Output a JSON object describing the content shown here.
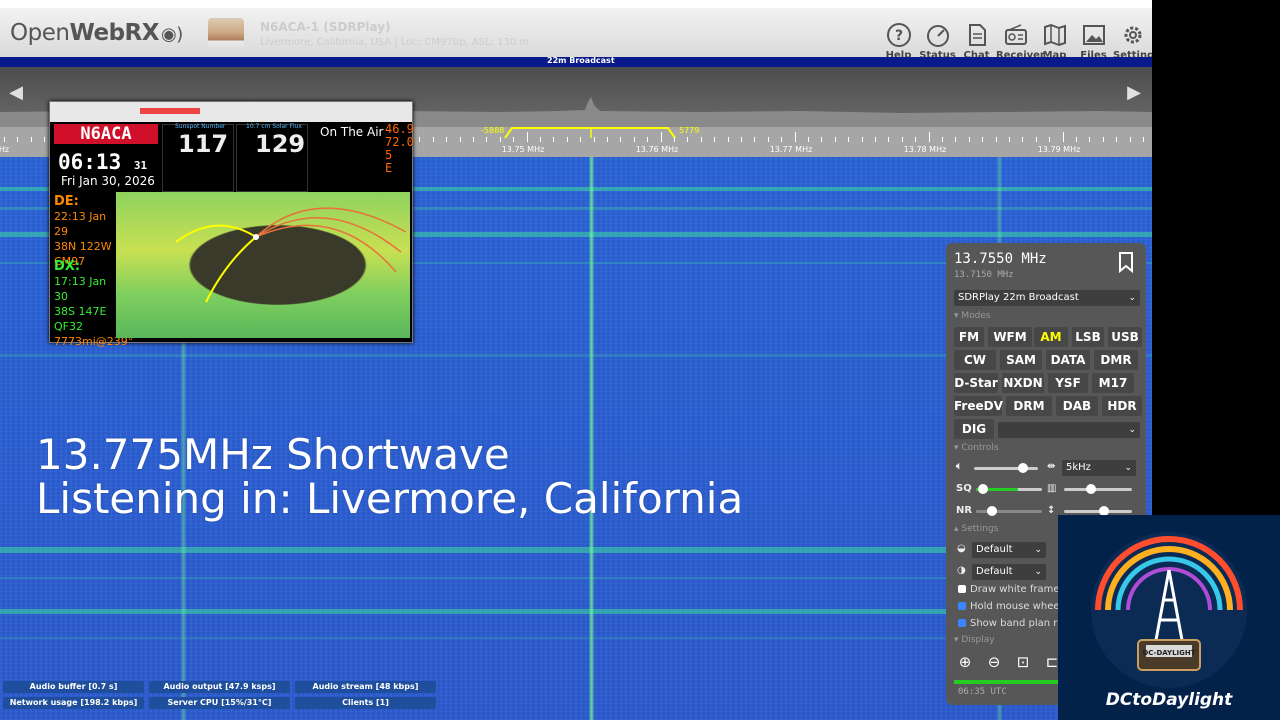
{
  "app": {
    "logo_light": "Open",
    "logo_bold": "WebRX",
    "receiver_name": "N6ACA-1 (SDRPlay)",
    "receiver_location": "Livermore, California, USA | Loc: CM97bp, ASL: 130 m"
  },
  "nav": [
    {
      "label": "Help",
      "icon": "help-icon"
    },
    {
      "label": "Status",
      "icon": "gauge-icon"
    },
    {
      "label": "Chat",
      "icon": "document-icon"
    },
    {
      "label": "Receiver",
      "icon": "radio-icon"
    },
    {
      "label": "Map",
      "icon": "map-icon"
    },
    {
      "label": "Files",
      "icon": "image-icon"
    },
    {
      "label": "Settings",
      "icon": "gear-icon"
    }
  ],
  "bandplan": {
    "label": "22m Broadcast"
  },
  "scale": {
    "labels": [
      "13.75 MHz",
      "13.76 MHz",
      "13.77 MHz",
      "13.78 MHz",
      "13.79 MHz"
    ],
    "left_edge_label": "Hz",
    "passband_low": "-5888",
    "passband_high": "5779"
  },
  "overlay": {
    "line1": "13.775MHz Shortwave",
    "line2": "Listening in: Livermore, California"
  },
  "inset": {
    "callsign": "N6ACA",
    "time": "06:13",
    "seconds": "31",
    "date": "Fri Jan 30, 2026",
    "sunspot": "117",
    "solar_flux": "129",
    "caption_sunspot": "Sunspot Number",
    "caption_flux": "10.7 cm Solar Flux",
    "on_air": "On The Air",
    "wx_temp": "46.9",
    "wx_humidity": "72.0",
    "wx_wind": "5",
    "wx_dir": "E",
    "de_label": "DE:",
    "de_time": "22:13 Jan 29",
    "de_latlon": "38N 122W",
    "de_grid": "CM97",
    "dx_label": "DX:",
    "dx_time": "17:13 Jan 30",
    "dx_latlon": "38S 147E",
    "dx_grid": "QF32",
    "dx_dist": "7773mi@239°"
  },
  "panel": {
    "frequency": "13.7550 MHz",
    "sub_frequency": "13.7150 MHz",
    "profile": "SDRPlay 22m Broadcast",
    "modes_label": "Modes",
    "modes": [
      "FM",
      "WFM",
      "AM",
      "LSB",
      "USB",
      "CW",
      "SAM",
      "DATA",
      "DMR",
      "D-Star",
      "NXDN",
      "YSF",
      "M17",
      "FreeDV",
      "DRM",
      "DAB",
      "HDR",
      "DIG"
    ],
    "active_mode": "AM",
    "controls_label": "Controls",
    "bandwidth": "5kHz",
    "sq_label": "SQ",
    "nr_label": "NR",
    "volume_level": 0.82,
    "squelch_level": 0.03,
    "nr_level": 0.2,
    "settings_label": "Settings",
    "theme_select": "Default",
    "colormap_select": "Default",
    "checks": [
      {
        "label": "Draw white frame",
        "checked": false
      },
      {
        "label": "Hold mouse wheel",
        "checked": true
      },
      {
        "label": "Show band plan ri",
        "checked": true
      }
    ],
    "display_label": "Display",
    "utc_clock": "06:35 UTC"
  },
  "status_bar": [
    {
      "label": "Audio buffer [0.7 s]"
    },
    {
      "label": "Audio output [47.9 ksps]"
    },
    {
      "label": "Audio stream [48 kbps]"
    },
    {
      "label": "Network usage [198.2 kbps]"
    },
    {
      "label": "Server CPU [15%/31°C]"
    },
    {
      "label": "Clients [1]"
    }
  ],
  "channel_logo": {
    "name": "DCtoDaylight",
    "badge": "DC-DAYLIGHT"
  },
  "colors": {
    "accent_active_mode": "#ffff00",
    "waterfall_base": "#2a5fcf",
    "band_strip": "#0a1a8a"
  }
}
